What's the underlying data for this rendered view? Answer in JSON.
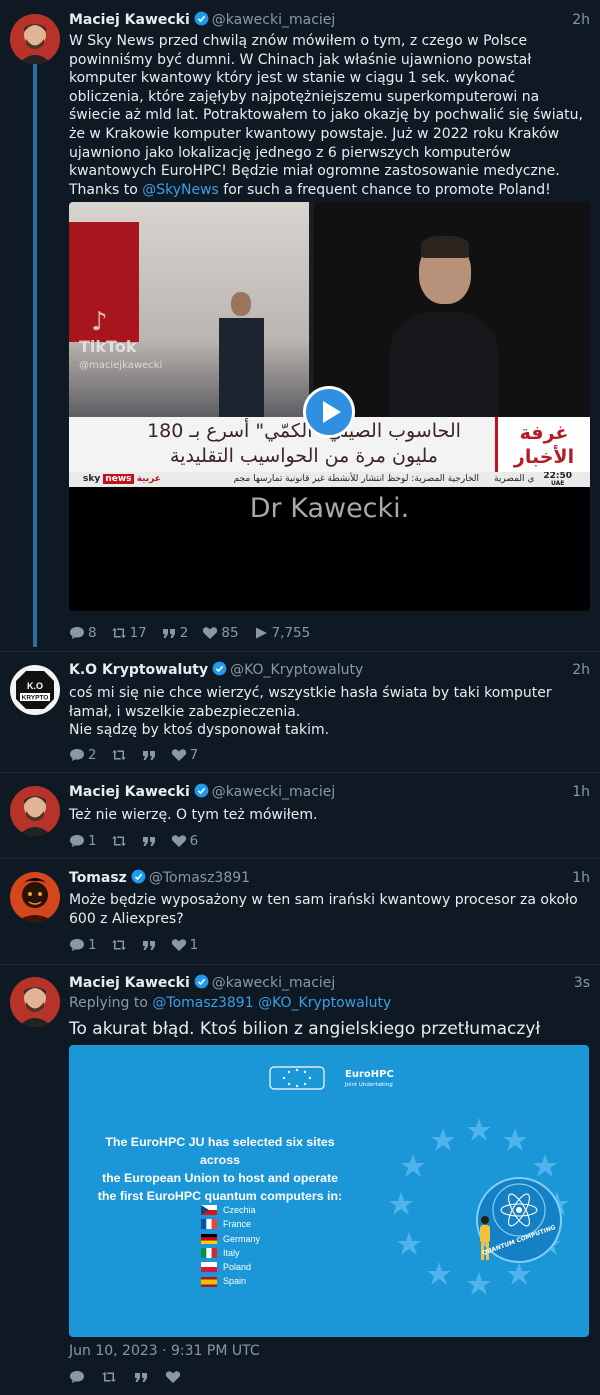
{
  "thread": {
    "tweet1": {
      "name": "Maciej Kawecki",
      "handle": "@kawecki_maciej",
      "time": "2h",
      "text_before": "W Sky News przed chwilą znów mówiłem o tym, z czego w Polsce powinniśmy być dumni. W Chinach jak właśnie ujawniono powstał komputer kwantowy który jest w stanie w ciągu 1 sek. wykonać obliczenia, które zajęłyby najpotężniejszemu superkomputerowi na świecie aż mld lat. Potraktowałem to jako okazję by pochwalić się światu, że w Krakowie komputer kwantowy powstaje. Już w 2022 roku Kraków ujawniono jako lokalizację jednego z 6 pierwszych komputerów kwantowych EuroHPC! Będzie miał ogromne zastosowanie medyczne. Thanks to ",
      "mention": "@SkyNews",
      "text_after": " for such a frequent chance to promote Poland!",
      "video": {
        "tiktok_label": "TikTok",
        "tiktok_user": "@maciejkawecki",
        "headline_line1": "الحاسوب الصيني \"الكمّي\" أسرع بـ 180",
        "headline_line2": "مليون مرة من الحواسيب التقليدية",
        "channel": "غرفة الأخبار",
        "ticker": "الخارجية المصرية: لوحظ انتشار للأنشطة غير قانونية تمارسها مجم",
        "ticker_right": "ي المصرية",
        "brand_sky": "sky",
        "brand_news": "news",
        "brand_arabic": "عربية",
        "clock": "22:50",
        "clock_sub": "UAE",
        "caption": "Dr Kawecki."
      },
      "stats": {
        "replies": "8",
        "retweets": "17",
        "quotes": "2",
        "likes": "85",
        "views": "7,755"
      }
    },
    "tweet2": {
      "name": "K.O Kryptowaluty",
      "handle": "@KO_Kryptowaluty",
      "time": "2h",
      "avatar_line1": "K.O",
      "avatar_line2": "KRYPTO",
      "text": "coś mi się nie chce wierzyć, wszystkie hasła świata by taki komputer łamał, i wszelkie zabezpieczenia.\nNie sądzę by ktoś dysponował takim.",
      "stats": {
        "replies": "2",
        "likes": "7"
      }
    },
    "tweet3": {
      "name": "Maciej Kawecki",
      "handle": "@kawecki_maciej",
      "time": "1h",
      "text": "Też nie wierzę. O tym też mówiłem.",
      "stats": {
        "replies": "1",
        "likes": "6"
      }
    },
    "tweet4": {
      "name": "Tomasz",
      "handle": "@Tomasz3891",
      "time": "1h",
      "text": "Może będzie wyposażony w ten sam irański kwantowy procesor za około 600  z Aliexpres?",
      "stats": {
        "replies": "1",
        "likes": "1"
      }
    },
    "tweet5": {
      "name": "Maciej Kawecki",
      "handle": "@kawecki_maciej",
      "time": "3s",
      "replying_label": "Replying to",
      "reply_to_1": "@Tomasz3891",
      "reply_to_2": "@KO_Kryptowaluty",
      "text": "To akurat błąd. Ktoś bilion z angielskiego przetłumaczył",
      "image": {
        "logo_title": "EuroHPC",
        "logo_sub": "Joint Undertaking",
        "heading_line1": "The EuroHPC JU has selected six sites across",
        "heading_line2": "the European Union to host and operate",
        "heading_line3": "the first EuroHPC quantum computers in:",
        "countries": [
          "Czechia",
          "France",
          "Germany",
          "Italy",
          "Poland",
          "Spain"
        ],
        "badge_text": "QUANTUM COMPUTING"
      },
      "date": "Jun 10, 2023 · 9:31 PM UTC"
    }
  },
  "colors": {
    "background": "#0f1923",
    "accent": "#3b9ee8",
    "thread_line": "#2a6fa8",
    "muted": "#8899a6",
    "verified": "#1d9bf0"
  }
}
